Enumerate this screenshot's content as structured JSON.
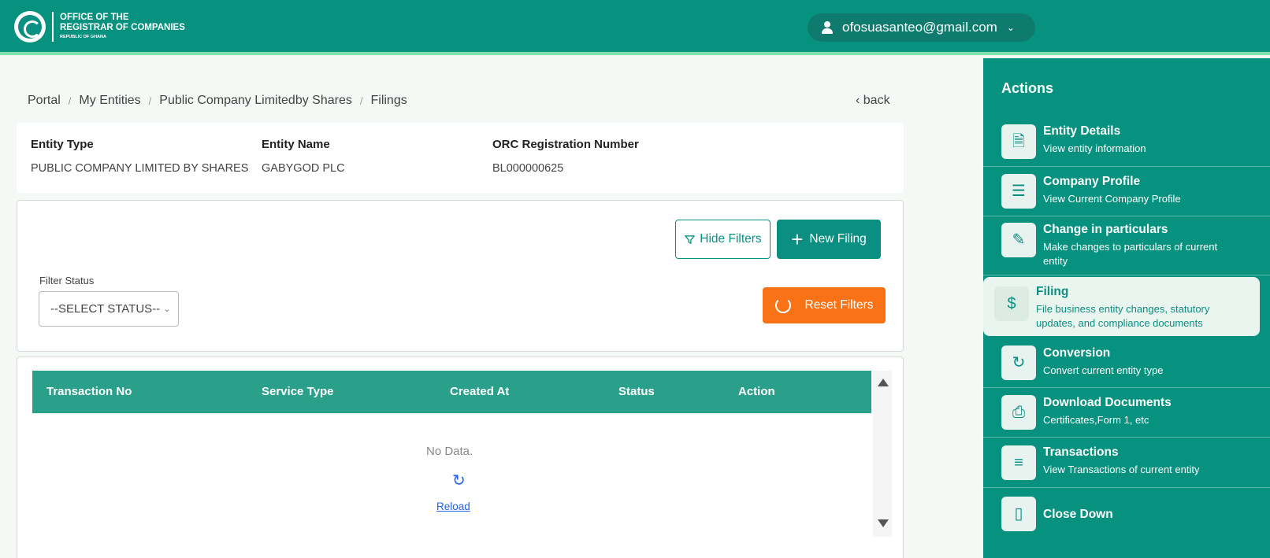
{
  "header": {
    "logo_line1": "OFFICE OF THE",
    "logo_line2": "REGISTRAR OF COMPANIES",
    "logo_line3": "REPUBLIC OF GHANA",
    "user_email": "ofosuasanteo@gmail.com"
  },
  "breadcrumb": [
    "Portal",
    "My Entities",
    "Public Company Limitedby Shares",
    "Filings"
  ],
  "back_label": "back",
  "entity": {
    "type_label": "Entity Type",
    "type_value": "PUBLIC COMPANY LIMITED BY SHARES",
    "name_label": "Entity Name",
    "name_value": "GABYGOD PLC",
    "reg_label": "ORC Registration Number",
    "reg_value": "BL000000625"
  },
  "filters": {
    "hide_label": "Hide Filters",
    "new_label": "New Filing",
    "status_label": "Filter Status",
    "status_value": "--SELECT STATUS--",
    "reset_label": "Reset Filters"
  },
  "table": {
    "columns": [
      "Transaction No",
      "Service Type",
      "Created At",
      "Status",
      "Action"
    ],
    "empty_text": "No Data.",
    "reload_label": "Reload"
  },
  "sidebar": {
    "title": "Actions",
    "items": [
      {
        "name": "Entity Details",
        "desc": "View entity information",
        "icon": "document-eye-icon"
      },
      {
        "name": "Company Profile",
        "desc": "View Current Company Profile",
        "icon": "list-icon"
      },
      {
        "name": "Change in particulars",
        "desc": "Make changes to particulars of current entity",
        "icon": "pen-icon"
      },
      {
        "name": "Filing",
        "desc": "File business entity changes, statutory updates, and compliance documents",
        "icon": "money-bag-icon"
      },
      {
        "name": "Conversion",
        "desc": "Convert current entity type",
        "icon": "document-refresh-icon"
      },
      {
        "name": "Download Documents",
        "desc": "Certificates,Form 1, etc",
        "icon": "printer-icon"
      },
      {
        "name": "Transactions",
        "desc": "View Transactions of current entity",
        "icon": "list-check-icon"
      },
      {
        "name": "Close Down",
        "desc": "",
        "icon": "door-exit-icon"
      }
    ]
  },
  "colors": {
    "primary": "#07917f",
    "accent_line": "#7ee3b0",
    "orange": "#f97316",
    "table_header": "#2aa08b",
    "link": "#2563eb"
  }
}
